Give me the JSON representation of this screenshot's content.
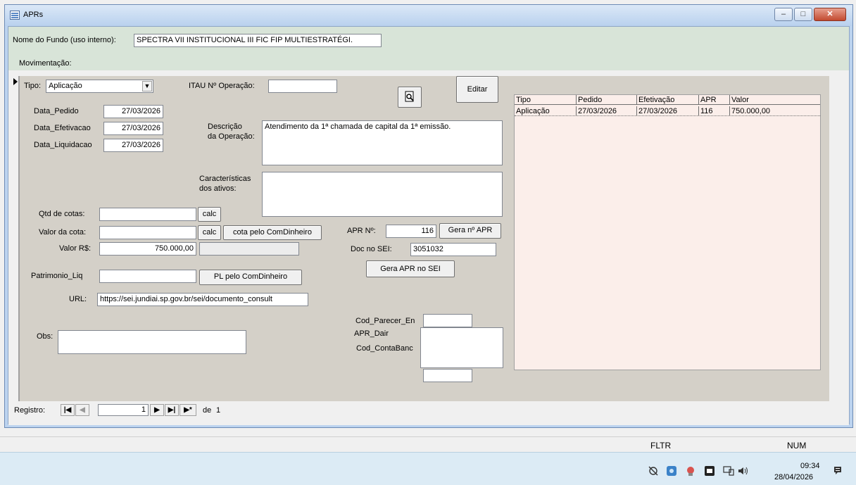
{
  "window": {
    "title": "APRs",
    "min": "–",
    "max": "□",
    "close": "✕"
  },
  "header": {
    "fund_label": "Nome do Fundo (uso interno):",
    "fund_value": "SPECTRA VII INSTITUCIONAL III FIC FIP MULTIESTRATÉGI.",
    "mov_label": "Movimentação:"
  },
  "form": {
    "tipo_label": "Tipo:",
    "tipo_value": "Aplicação",
    "itau_label": "ITAU Nº Operação:",
    "itau_value": "",
    "editar": "Editar",
    "data_pedido_label": "Data_Pedido",
    "data_pedido_value": "27/03/2026",
    "data_efetivacao_label": "Data_Efetivacao",
    "data_efetivacao_value": "27/03/2026",
    "data_liquidacao_label": "Data_Liquidacao",
    "data_liquidacao_value": "27/03/2026",
    "descricao_label1": "Descrição",
    "descricao_label2": "da Operação:",
    "descricao_value": "Atendimento da 1ª chamada de capital da 1ª emissão.",
    "caract_label1": "Características",
    "caract_label2": "dos ativos:",
    "caract_value": "",
    "qtd_label": "Qtd de cotas:",
    "qtd_value": "",
    "calc": "calc",
    "valor_cota_label": "Valor da cota:",
    "valor_cota_value": "",
    "cota_btn": "cota pelo ComDinheiro",
    "valor_rs_label": "Valor R$:",
    "valor_rs_value": "750.000,00",
    "valor_extra": "",
    "apr_no_label": "APR Nº:",
    "apr_no_value": "116",
    "gera_apr": "Gera nº APR",
    "doc_sei_label": "Doc no SEI:",
    "doc_sei_value": "3051032",
    "gera_sei": "Gera APR no SEI",
    "pl_label": "Patrimonio_Liq",
    "pl_value": "",
    "pl_btn": "PL pelo ComDinheiro",
    "url_label": "URL:",
    "url_value": "https://sei.jundiai.sp.gov.br/sei/documento_consult",
    "obs_label": "Obs:",
    "obs_value": "",
    "cod_parecer_label": "Cod_Parecer_En",
    "apr_dair_label": "APR_Dair",
    "cod_conta_label": "Cod_ContaBanc"
  },
  "grid": {
    "headers": [
      "Tipo",
      "Pedido",
      "Efetivação",
      "APR",
      "Valor"
    ],
    "rows": [
      [
        "Aplicação",
        "27/03/2026",
        "27/03/2026",
        "116",
        "750.000,00"
      ]
    ]
  },
  "nav": {
    "label": "Registro:",
    "current": "1",
    "of": "de",
    "total": "1"
  },
  "status": {
    "fltr": "FLTR",
    "num": "NUM"
  },
  "taskbar": {
    "time": "09:34",
    "date": "28/04/2026"
  }
}
